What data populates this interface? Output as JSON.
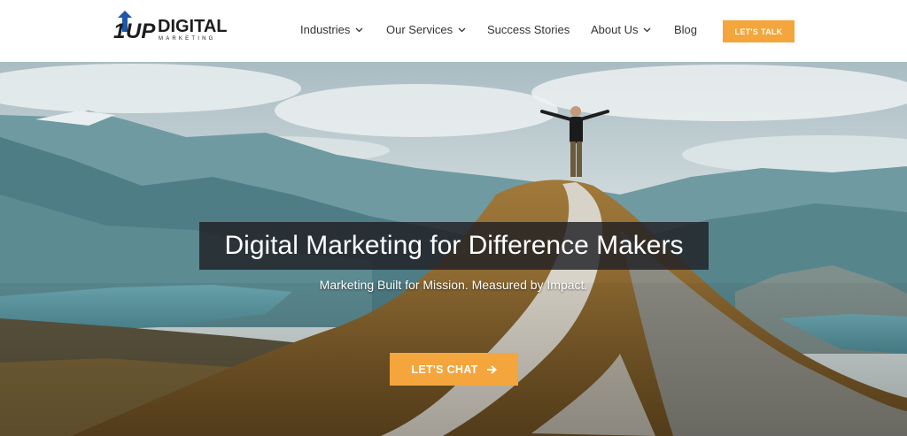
{
  "brand": {
    "logo_text": "DIGITAL",
    "logo_subtext": "MARKETING",
    "logo_mark": "1UP"
  },
  "nav": {
    "items": [
      {
        "label": "Industries",
        "has_dropdown": true
      },
      {
        "label": "Our Services",
        "has_dropdown": true
      },
      {
        "label": "Success Stories",
        "has_dropdown": false
      },
      {
        "label": "About Us",
        "has_dropdown": true
      },
      {
        "label": "Blog",
        "has_dropdown": false
      }
    ],
    "cta_label": "LET'S TALK"
  },
  "hero": {
    "title": "Digital Marketing for Difference Makers",
    "subtitle": "Marketing Built for Mission. Measured by Impact.",
    "cta_label": "LET'S CHAT"
  },
  "colors": {
    "accent": "#f4a53b",
    "logo_blue": "#1e57a8",
    "logo_dark": "#1d1d1f",
    "nav_text": "#333333"
  },
  "icons": {
    "dropdown": "chevron-down-icon",
    "cta_arrow": "arrow-right-icon"
  }
}
